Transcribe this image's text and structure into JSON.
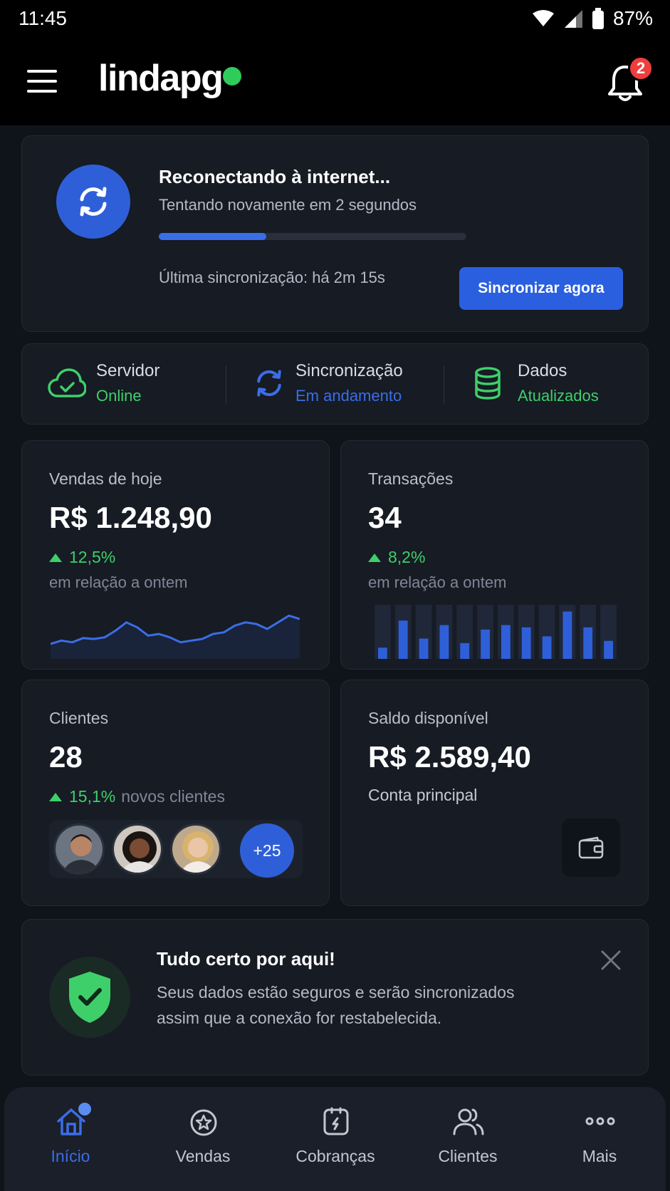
{
  "status_bar": {
    "time": "11:45",
    "battery": "87%"
  },
  "header": {
    "logo": "lindapg",
    "notification_count": "2"
  },
  "reconnect": {
    "title": "Reconectando à internet...",
    "subtitle": "Tentando novamente em 2 segundos",
    "progress": 0.35,
    "last_sync": "Última sincronização: há 2m 15s",
    "button": "Sincronizar agora"
  },
  "status": [
    {
      "label": "Servidor",
      "value": "Online",
      "color": "#3fcf6a",
      "icon": "cloud-check-icon"
    },
    {
      "label": "Sincronização",
      "value": "Em andamento",
      "color": "#3b6de6",
      "icon": "sync-icon"
    },
    {
      "label": "Dados",
      "value": "Atualizados",
      "color": "#3fcf6a",
      "icon": "database-icon"
    }
  ],
  "metrics": {
    "sales": {
      "title": "Vendas de hoje",
      "value": "R$ 1.248,90",
      "change": "12,5%",
      "note": "em relação a ontem"
    },
    "transactions": {
      "title": "Transações",
      "value": "34",
      "change": "8,2%",
      "note": "em relação a ontem"
    },
    "clients": {
      "title": "Clientes",
      "value": "28",
      "change": "15,1%",
      "note": "novos clientes",
      "more": "+25"
    },
    "balance": {
      "title": "Saldo disponível",
      "value": "R$ 2.589,40",
      "note": "Conta principal"
    }
  },
  "sparkline": [
    18,
    22,
    20,
    25,
    24,
    26,
    34,
    44,
    38,
    28,
    30,
    26,
    20,
    22,
    24,
    30,
    32,
    40,
    44,
    42,
    36,
    44,
    52,
    48
  ],
  "bars": [
    10,
    34,
    18,
    30,
    14,
    26,
    30,
    28,
    20,
    42,
    28,
    16
  ],
  "security": {
    "title": "Tudo certo por aqui!",
    "text": "Seus dados estão seguros e serão sincronizados assim que a conexão for restabelecida."
  },
  "nav": [
    {
      "label": "Início",
      "icon": "home-icon",
      "active": true
    },
    {
      "label": "Vendas",
      "icon": "sales-icon",
      "active": false
    },
    {
      "label": "Cobranças",
      "icon": "billing-icon",
      "active": false
    },
    {
      "label": "Clientes",
      "icon": "clients-icon",
      "active": false
    },
    {
      "label": "Mais",
      "icon": "more-icon",
      "active": false
    }
  ],
  "colors": {
    "accent": "#2f5fd8",
    "success": "#3fcf6a",
    "danger": "#ef3e3e",
    "background": "#0f131a"
  }
}
